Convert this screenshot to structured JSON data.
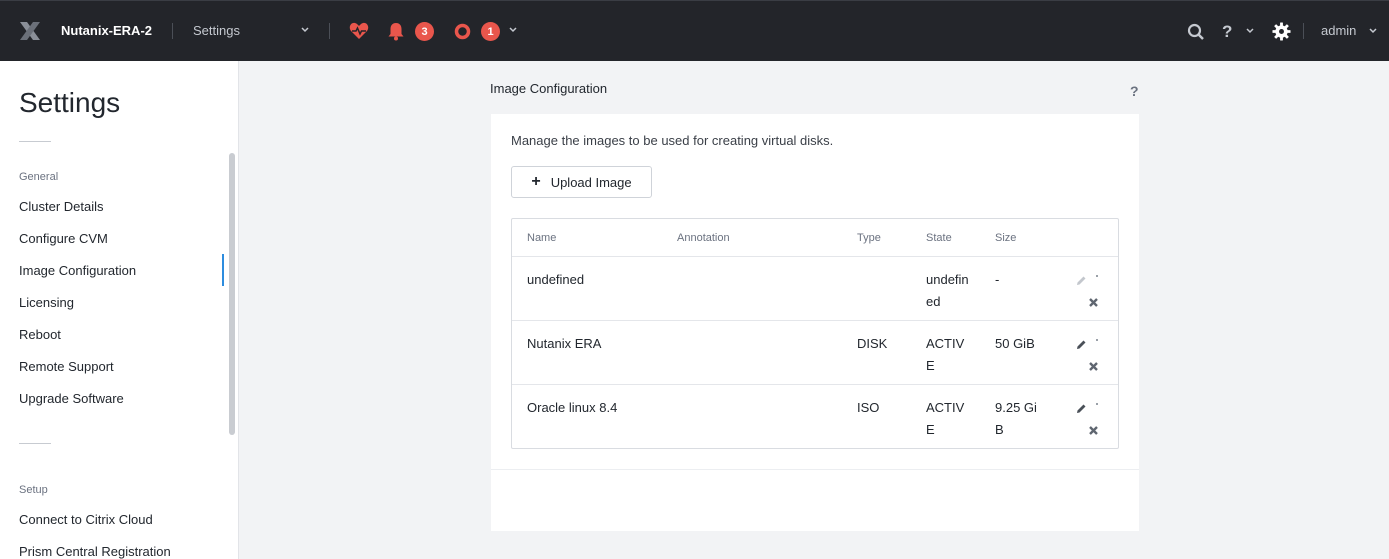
{
  "topbar": {
    "cluster_name": "Nutanix-ERA-2",
    "nav_selected": "Settings",
    "alerts_count": "3",
    "tasks_count": "1",
    "user": "admin",
    "help_label": "?"
  },
  "sidebar": {
    "title": "Settings",
    "sections": [
      {
        "label": "General",
        "items": [
          {
            "label": "Cluster Details"
          },
          {
            "label": "Configure CVM"
          },
          {
            "label": "Image Configuration",
            "active": true
          },
          {
            "label": "Licensing"
          },
          {
            "label": "Reboot"
          },
          {
            "label": "Remote Support"
          },
          {
            "label": "Upgrade Software"
          }
        ]
      },
      {
        "label": "Setup",
        "items": [
          {
            "label": "Connect to Citrix Cloud"
          },
          {
            "label": "Prism Central Registration"
          }
        ]
      }
    ]
  },
  "main": {
    "title": "Image Configuration",
    "help_label": "?",
    "description": "Manage the images to be used for creating virtual disks.",
    "upload_label": "Upload Image",
    "table": {
      "headers": {
        "name": "Name",
        "annotation": "Annotation",
        "type": "Type",
        "state": "State",
        "size": "Size"
      },
      "rows": [
        {
          "name": "undefined",
          "annotation": "",
          "type": "",
          "state": "undefined",
          "size": "-"
        },
        {
          "name": "Nutanix ERA",
          "annotation": "",
          "type": "DISK",
          "state": "ACTIVE",
          "size": "50 GiB"
        },
        {
          "name": "Oracle linux 8.4",
          "annotation": "",
          "type": "ISO",
          "state": "ACTIVE",
          "size": "9.25 GiB"
        }
      ]
    }
  },
  "colors": {
    "topbar_bg": "#23252a",
    "badge": "#e9564c",
    "active_indicator": "#2d8cde"
  }
}
